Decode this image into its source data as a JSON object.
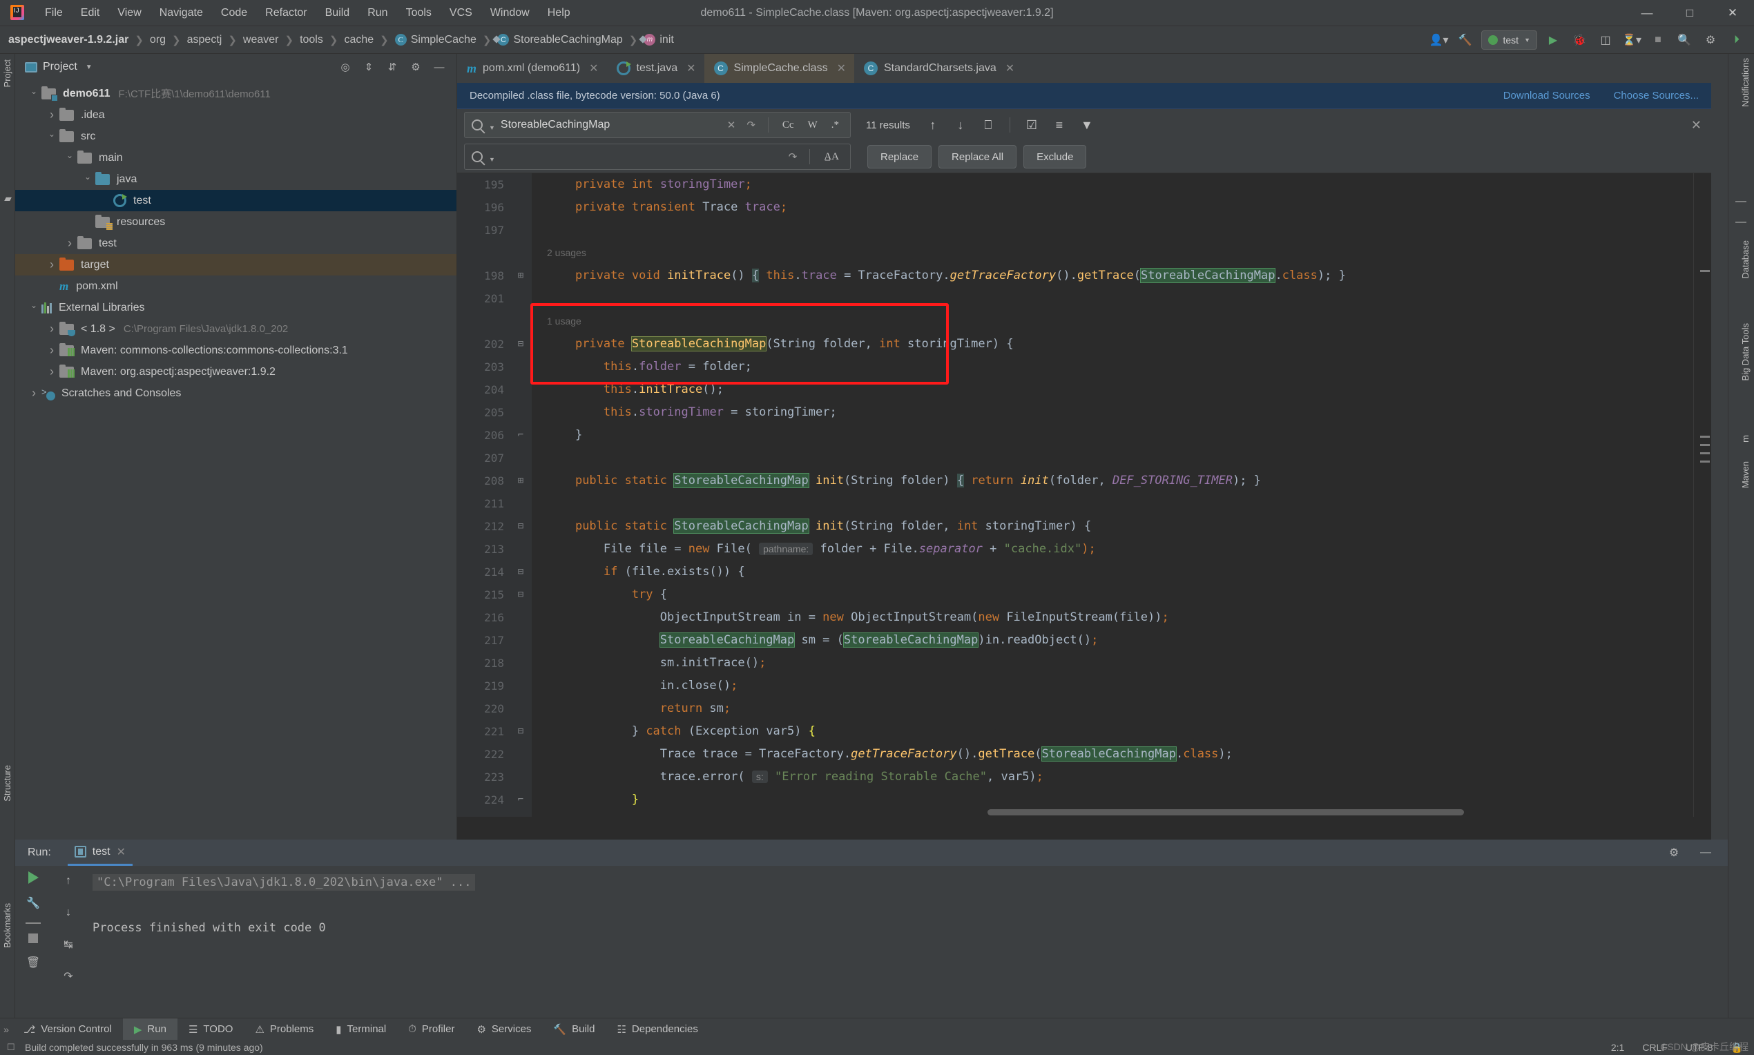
{
  "window": {
    "title": "demo611 - SimpleCache.class [Maven: org.aspectj:aspectjweaver:1.9.2]",
    "minimize": "—",
    "maximize": "□",
    "close": "✕"
  },
  "menu": [
    "File",
    "Edit",
    "View",
    "Navigate",
    "Code",
    "Refactor",
    "Build",
    "Run",
    "Tools",
    "VCS",
    "Window",
    "Help"
  ],
  "navbar": {
    "crumbs": [
      "aspectjweaver-1.9.2.jar",
      "org",
      "aspectj",
      "weaver",
      "tools",
      "cache",
      "SimpleCache",
      "StoreableCachingMap",
      "init"
    ],
    "separator": "❯",
    "run_config": "test",
    "icons": [
      "user-icon",
      "hammer-icon",
      "run-icon",
      "debug-icon",
      "coverage-icon",
      "profile-icon",
      "stop-icon",
      "search-icon",
      "settings-icon",
      "updates-icon"
    ]
  },
  "project_panel": {
    "title": "Project",
    "tools": [
      "collapse-all-icon",
      "expand-all-icon",
      "settings-icon",
      "hide-icon"
    ],
    "tree": [
      {
        "label": "demo611",
        "path": "F:\\CTF比赛\\1\\demo611\\demo611",
        "indent": 0,
        "arrow": "down",
        "icon": "module-folder",
        "bold": true
      },
      {
        "label": ".idea",
        "path": "",
        "indent": 1,
        "arrow": "right",
        "icon": "folder",
        "bold": false
      },
      {
        "label": "src",
        "path": "",
        "indent": 1,
        "arrow": "down",
        "icon": "folder",
        "bold": false
      },
      {
        "label": "main",
        "path": "",
        "indent": 2,
        "arrow": "down",
        "icon": "folder",
        "bold": false
      },
      {
        "label": "java",
        "path": "",
        "indent": 3,
        "arrow": "down",
        "icon": "folder-blue",
        "bold": false
      },
      {
        "label": "test",
        "path": "",
        "indent": 4,
        "arrow": "none",
        "icon": "test-class",
        "bold": false,
        "selected": true
      },
      {
        "label": "resources",
        "path": "",
        "indent": 3,
        "arrow": "none",
        "icon": "folder-resources",
        "bold": false
      },
      {
        "label": "test",
        "path": "",
        "indent": 2,
        "arrow": "right",
        "icon": "folder",
        "bold": false
      },
      {
        "label": "target",
        "path": "",
        "indent": 1,
        "arrow": "right",
        "icon": "folder-orange",
        "bold": false,
        "highlighted": true
      },
      {
        "label": "pom.xml",
        "path": "",
        "indent": 1,
        "arrow": "none",
        "icon": "maven-file",
        "bold": false
      },
      {
        "label": "External Libraries",
        "path": "",
        "indent": 0,
        "arrow": "down",
        "icon": "libraries",
        "bold": false
      },
      {
        "label": "< 1.8 >",
        "path": "C:\\Program Files\\Java\\jdk1.8.0_202",
        "indent": 1,
        "arrow": "right",
        "icon": "jdk",
        "bold": false
      },
      {
        "label": "Maven: commons-collections:commons-collections:3.1",
        "path": "",
        "indent": 1,
        "arrow": "right",
        "icon": "maven-lib",
        "bold": false
      },
      {
        "label": "Maven: org.aspectj:aspectjweaver:1.9.2",
        "path": "",
        "indent": 1,
        "arrow": "right",
        "icon": "maven-lib",
        "bold": false
      },
      {
        "label": "Scratches and Consoles",
        "path": "",
        "indent": 0,
        "arrow": "right",
        "icon": "scratches",
        "bold": false
      }
    ]
  },
  "editor": {
    "tabs": [
      {
        "label": "pom.xml (demo611)",
        "icon": "maven-file-icon",
        "active": false
      },
      {
        "label": "test.java",
        "icon": "test-class-icon",
        "active": false
      },
      {
        "label": "SimpleCache.class",
        "icon": "decompiled-class-icon",
        "active": true
      },
      {
        "label": "StandardCharsets.java",
        "icon": "decompiled-class-icon",
        "active": false
      }
    ],
    "tab_close": "✕",
    "decompiled_notice": "Decompiled .class file, bytecode version: 50.0 (Java 6)",
    "download_sources": "Download Sources",
    "choose_sources": "Choose Sources..."
  },
  "find": {
    "search_value": "StoreableCachingMap",
    "replace_placeholder": "",
    "results": "11 results",
    "case_label": "Cc",
    "word_label": "W",
    "regex_label": ".*",
    "preserve_case_label": "A̲A",
    "buttons": {
      "replace": "Replace",
      "replace_all": "Replace All",
      "exclude": "Exclude"
    },
    "icons": [
      "prev-match-icon",
      "next-match-icon",
      "select-all-occurrences-icon",
      "find-in-selection-icon",
      "filter-options-icon",
      "filter-icon",
      "close-find-icon"
    ]
  },
  "code": {
    "lines": [
      {
        "num": "195",
        "fold": "",
        "usage": "",
        "html": "    <span class='kw'>private</span> <span class='kw'>int</span> <span class='fld'>storingTimer</span><span class='kw'>;</span>"
      },
      {
        "num": "196",
        "fold": "",
        "usage": "",
        "html": "    <span class='kw'>private transient</span> <span class='plain'>Trace</span> <span class='fld'>trace</span><span class='kw'>;</span>"
      },
      {
        "num": "197",
        "fold": "",
        "usage": "",
        "html": ""
      },
      {
        "num": "",
        "fold": "",
        "usage": "2 usages",
        "html": ""
      },
      {
        "num": "198",
        "fold": "plus",
        "usage": "",
        "html": "    <span class='kw'>private</span> <span class='kw'>void</span> <span class='mth'>initTrace</span><span class='plain'>()</span> <span class='brace-hl'>{</span> <span class='kw'>this</span><span class='plain'>.</span><span class='fld'>trace</span> <span class='plain'>= TraceFactory.</span><span class='mthi'>getTraceFactory</span><span class='plain'>().</span><span class='mth'>getTrace</span><span class='plain'>(</span><span class='hl-green'>StoreableCachingMap</span><span class='plain'>.</span><span class='kw'>class</span><span class='plain'>); }</span>"
      },
      {
        "num": "201",
        "fold": "",
        "usage": "",
        "html": ""
      },
      {
        "num": "",
        "fold": "",
        "usage": "1 usage",
        "html": ""
      },
      {
        "num": "202",
        "fold": "minus",
        "usage": "",
        "html": "    <span class='kw'>private</span> <span class='hl-amber'>StoreableCachingMap</span><span class='plain'>(String folder, </span><span class='kw'>int</span><span class='plain'> storingTimer) {</span>"
      },
      {
        "num": "203",
        "fold": "",
        "usage": "",
        "html": "        <span class='kw'>this</span><span class='plain'>.</span><span class='fld'>folder</span> <span class='plain'>= folder;</span>"
      },
      {
        "num": "204",
        "fold": "",
        "usage": "",
        "html": "        <span class='kw'>this</span><span class='plain'>.</span><span class='mth'>initTrace</span><span class='plain'>();</span>"
      },
      {
        "num": "205",
        "fold": "",
        "usage": "",
        "html": "        <span class='kw'>this</span><span class='plain'>.</span><span class='fld'>storingTimer</span> <span class='plain'>= storingTimer;</span>"
      },
      {
        "num": "206",
        "fold": "end",
        "usage": "",
        "html": "    <span class='plain'>}</span>"
      },
      {
        "num": "207",
        "fold": "",
        "usage": "",
        "html": ""
      },
      {
        "num": "208",
        "fold": "plus",
        "usage": "",
        "html": "    <span class='kw'>public static</span> <span class='hl-green'>StoreableCachingMap</span> <span class='mth'>init</span><span class='plain'>(String folder) </span><span class='brace-hl'>{</span> <span class='kw'>return</span> <span class='mthi'>init</span><span class='plain'>(folder, </span><span class='sfld'>DEF_STORING_TIMER</span><span class='plain'>); }</span>"
      },
      {
        "num": "211",
        "fold": "",
        "usage": "",
        "html": ""
      },
      {
        "num": "212",
        "fold": "minus",
        "usage": "",
        "html": "    <span class='kw'>public static</span> <span class='hl-green'>StoreableCachingMap</span> <span class='mth'>init</span><span class='plain'>(String folder, </span><span class='kw'>int</span><span class='plain'> storingTimer) {</span>"
      },
      {
        "num": "213",
        "fold": "",
        "usage": "",
        "html": "        <span class='plain'>File file = </span><span class='kw'>new</span><span class='plain'> File( </span><span class='hint'>pathname:</span><span class='plain'> folder + File.</span><span class='sfld'>separator</span><span class='plain'> + </span><span class='str'>\"cache.idx\"</span><span class='kw'>);</span>"
      },
      {
        "num": "214",
        "fold": "minus",
        "usage": "",
        "html": "        <span class='kw'>if</span><span class='plain'> (file.exists()) {</span>"
      },
      {
        "num": "215",
        "fold": "minus",
        "usage": "",
        "html": "            <span class='kw'>try</span><span class='plain'> {</span>"
      },
      {
        "num": "216",
        "fold": "",
        "usage": "",
        "html": "                <span class='plain'>ObjectInputStream in = </span><span class='kw'>new</span><span class='plain'> ObjectInputStream(</span><span class='kw'>new</span><span class='plain'> FileInputStream(file))</span><span class='kw'>;</span>"
      },
      {
        "num": "217",
        "fold": "",
        "usage": "",
        "html": "                <span class='hl-green'>StoreableCachingMap</span><span class='plain'> sm = (</span><span class='hl-green'>StoreableCachingMap</span><span class='plain'>)in.readObject()</span><span class='kw'>;</span>"
      },
      {
        "num": "218",
        "fold": "",
        "usage": "",
        "html": "                <span class='plain'>sm.initTrace()</span><span class='kw'>;</span>"
      },
      {
        "num": "219",
        "fold": "",
        "usage": "",
        "html": "                <span class='plain'>in.close()</span><span class='kw'>;</span>"
      },
      {
        "num": "220",
        "fold": "",
        "usage": "",
        "html": "                <span class='kw'>return</span><span class='plain'> sm</span><span class='kw'>;</span>"
      },
      {
        "num": "221",
        "fold": "minus",
        "usage": "",
        "html": "            <span class='plain'>} </span><span class='kw'>catch</span><span class='plain'> (Exception var5) </span><span class='cursor-brace'>{</span>"
      },
      {
        "num": "222",
        "fold": "",
        "usage": "",
        "html": "                <span class='plain'>Trace trace = TraceFactory.</span><span class='mthi'>getTraceFactory</span><span class='plain'>().</span><span class='mth'>getTrace</span><span class='plain'>(</span><span class='hl-green'>StoreableCachingMap</span><span class='plain'>.</span><span class='kw'>class</span><span class='plain'>);</span>"
      },
      {
        "num": "223",
        "fold": "",
        "usage": "",
        "html": "                <span class='plain'>trace.error( </span><span class='hint'>s:</span> <span class='str'>\"Error reading Storable Cache\"</span><span class='plain'>, var5)</span><span class='kw'>;</span>"
      },
      {
        "num": "224",
        "fold": "end",
        "usage": "",
        "html": "            <span class='cursor-brace'>}</span>"
      }
    ]
  },
  "run_panel": {
    "label": "Run:",
    "tab": "test",
    "tab_close": "✕",
    "command": "\"C:\\Program Files\\Java\\jdk1.8.0_202\\bin\\java.exe\" ...",
    "output": "Process finished with exit code 0",
    "side_icons": [
      "rerun-icon",
      "settings-icon",
      "stop-icon",
      "up-icon",
      "down-icon",
      "soft-wrap-icon",
      "print-icon"
    ],
    "head_right": [
      "settings-icon",
      "hide-icon"
    ]
  },
  "bottom_bar": [
    {
      "label": "Version Control",
      "icon": "branch-icon",
      "active": false
    },
    {
      "label": "Run",
      "icon": "run-icon",
      "active": true
    },
    {
      "label": "TODO",
      "icon": "todo-icon",
      "active": false
    },
    {
      "label": "Problems",
      "icon": "problems-icon",
      "active": false
    },
    {
      "label": "Terminal",
      "icon": "terminal-icon",
      "active": false
    },
    {
      "label": "Profiler",
      "icon": "profiler-icon",
      "active": false
    },
    {
      "label": "Services",
      "icon": "services-icon",
      "active": false
    },
    {
      "label": "Build",
      "icon": "build-icon",
      "active": false
    },
    {
      "label": "Dependencies",
      "icon": "dependencies-icon",
      "active": false
    }
  ],
  "status_bar": {
    "message": "Build completed successfully in 963 ms (9 minutes ago)",
    "position": "2:1",
    "line_sep": "CRLF",
    "encoding": "UTF-8",
    "watermark": "CSDN @皮卡丘编程"
  },
  "left_strip": [
    "Project",
    "Structure",
    "Bookmarks"
  ],
  "right_strip": [
    "Notifications",
    "Database",
    "Big Data Tools",
    "m",
    "Maven"
  ],
  "colors": {
    "accent_blue": "#4a88c7",
    "highlight_green": "#32593d",
    "highlight_amber": "#3f4a2c",
    "redbox": "#ff1a1a",
    "selection": "#0d293e",
    "editor_bg": "#2b2b2b",
    "panel_bg": "#3c3f41"
  }
}
